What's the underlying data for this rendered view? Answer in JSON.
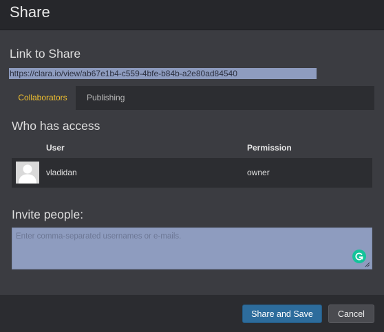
{
  "dialog": {
    "title": "Share"
  },
  "link": {
    "heading": "Link to Share",
    "url": "https://clara.io/view/ab67e1b4-c559-4bfe-b84b-a2e80ad84540"
  },
  "tabs": [
    {
      "label": "Collaborators",
      "active": true
    },
    {
      "label": "Publishing",
      "active": false
    }
  ],
  "access": {
    "heading": "Who has access",
    "columns": {
      "user": "User",
      "permission": "Permission"
    },
    "rows": [
      {
        "user": "vladidan",
        "permission": "owner",
        "avatar_icon": "default-user-avatar"
      }
    ]
  },
  "invite": {
    "heading": "Invite people:",
    "placeholder": "Enter comma-separated usernames or e-mails.",
    "value": "",
    "assistant_icon": "grammarly-icon"
  },
  "footer": {
    "save_label": "Share and Save",
    "cancel_label": "Cancel"
  },
  "colors": {
    "accent_tab": "#f0c030",
    "primary_button": "#2d6c9c",
    "selection": "#8e9cbf",
    "grammarly": "#15c39a"
  }
}
